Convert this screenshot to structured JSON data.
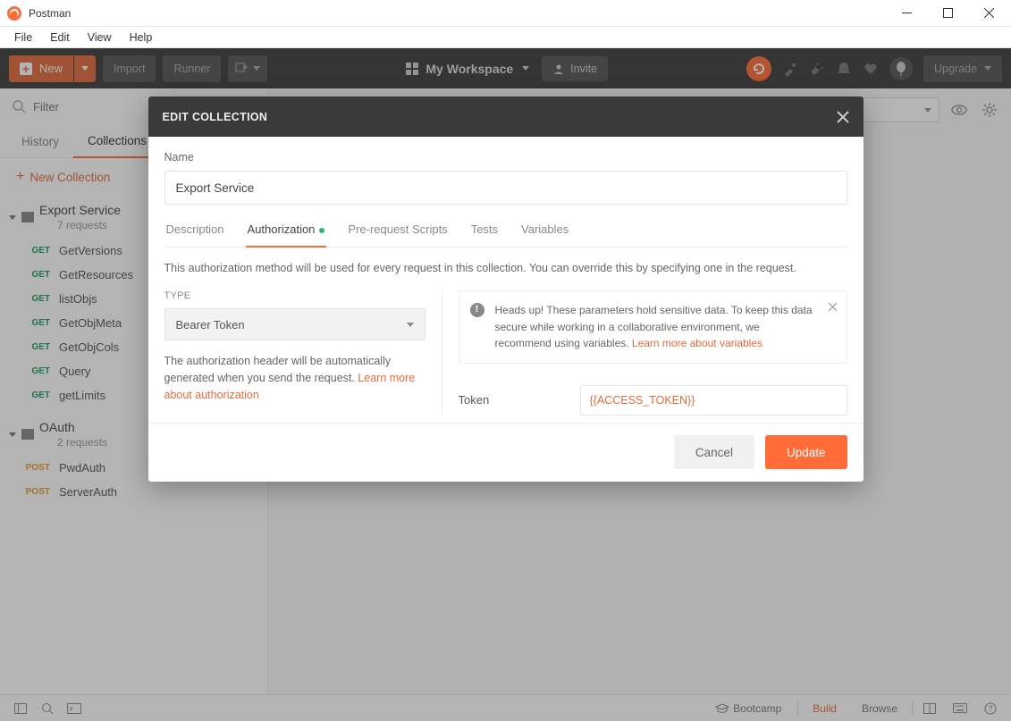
{
  "titlebar": {
    "app_name": "Postman"
  },
  "menubar": [
    "File",
    "Edit",
    "View",
    "Help"
  ],
  "toolbar": {
    "new_label": "New",
    "import_label": "Import",
    "runner_label": "Runner",
    "workspace_label": "My Workspace",
    "invite_label": "Invite",
    "upgrade_label": "Upgrade"
  },
  "sidebar": {
    "filter_placeholder": "Filter",
    "tabs": {
      "history": "History",
      "collections": "Collections"
    },
    "new_collection": "New Collection",
    "collections": [
      {
        "name": "Export Service",
        "count": "7 requests",
        "items": [
          {
            "method": "GET",
            "name": "GetVersions"
          },
          {
            "method": "GET",
            "name": "GetResources"
          },
          {
            "method": "GET",
            "name": "listObjs"
          },
          {
            "method": "GET",
            "name": "GetObjMeta"
          },
          {
            "method": "GET",
            "name": "GetObjCols"
          },
          {
            "method": "GET",
            "name": "Query"
          },
          {
            "method": "GET",
            "name": "getLimits"
          }
        ]
      },
      {
        "name": "OAuth",
        "count": "2 requests",
        "items": [
          {
            "method": "POST",
            "name": "PwdAuth"
          },
          {
            "method": "POST",
            "name": "ServerAuth"
          }
        ]
      }
    ]
  },
  "statusbar": {
    "bootcamp": "Bootcamp",
    "build": "Build",
    "browse": "Browse"
  },
  "modal": {
    "title": "EDIT COLLECTION",
    "name_label": "Name",
    "name_value": "Export Service",
    "tabs": [
      "Description",
      "Authorization",
      "Pre-request Scripts",
      "Tests",
      "Variables"
    ],
    "active_tab": 1,
    "description": "This authorization method will be used for every request in this collection. You can override this by specifying one in the request.",
    "type_label": "TYPE",
    "type_value": "Bearer Token",
    "auth_para_pre": "The authorization header will be automatically generated when you send the request. ",
    "auth_para_link": "Learn more about authorization",
    "warn_text": "Heads up! These parameters hold sensitive data. To keep this data secure while working in a collaborative environment, we recommend using variables. ",
    "warn_link": "Learn more about variables",
    "token_label": "Token",
    "token_value": "{{ACCESS_TOKEN}}",
    "cancel": "Cancel",
    "update": "Update"
  }
}
